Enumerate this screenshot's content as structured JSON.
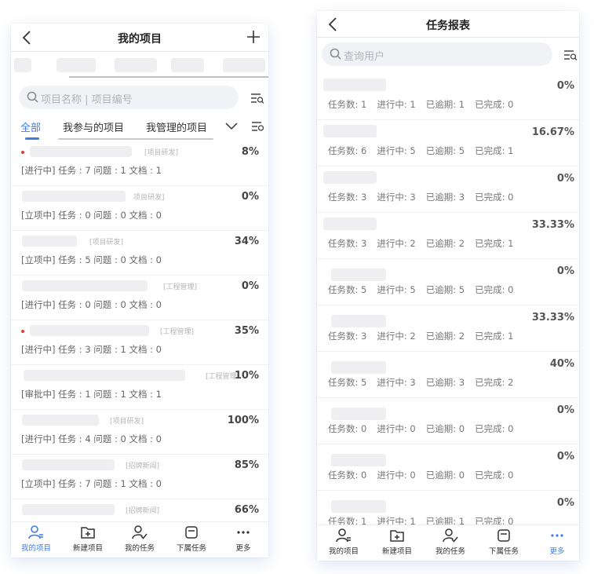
{
  "left_screen": {
    "title": "我的项目",
    "search_placeholder": "项目名称 | 项目编号",
    "tabs": [
      "全部",
      "我参与的项目",
      "我管理的项目"
    ],
    "projects": [
      {
        "tag": "[项目研发]",
        "percent": "8%",
        "meta": "[进行中] 任务 : 7 问题 : 1 文档 : 1",
        "has_dot": true
      },
      {
        "tag": "项目研发]",
        "percent": "0%",
        "meta": "[立项中] 任务 : 0 问题 : 0 文档 : 0",
        "has_dot": false
      },
      {
        "tag": "[项目研发]",
        "percent": "34%",
        "meta": "[立项中] 任务 : 5 问题 : 0 文档 : 0",
        "has_dot": false
      },
      {
        "tag": "[工程管理]",
        "percent": "0%",
        "meta": "[进行中] 任务 : 0 问题 : 0 文档 : 0",
        "has_dot": false
      },
      {
        "tag": "[工程管理]",
        "percent": "35%",
        "meta": "[进行中] 任务 : 3 问题 : 1 文档 : 0",
        "has_dot": true
      },
      {
        "tag": "[工程管理]",
        "percent": "10%",
        "meta": "[审批中] 任务 : 1 问题 : 1 文档 : 1",
        "has_dot": false
      },
      {
        "tag": "[项目研发]",
        "percent": "100%",
        "meta": "[进行中] 任务 : 4 问题 : 0 文档 : 0",
        "has_dot": false
      },
      {
        "tag": "[招牌新闻]",
        "percent": "85%",
        "meta": "[立项中] 任务 : 7 问题 : 1 文档 : 0",
        "has_dot": false
      },
      {
        "tag": "[招牌新闻]",
        "percent": "66%",
        "meta": "",
        "has_dot": false
      }
    ]
  },
  "right_screen": {
    "title": "任务报表",
    "search_placeholder": "查询用户",
    "rows": [
      {
        "percent": "0%",
        "tasks": "任务数: 1",
        "in_progress": "进行中: 1",
        "overdue": "已逾期: 1",
        "done": "已完成: 0"
      },
      {
        "percent": "16.67%",
        "tasks": "任务数: 6",
        "in_progress": "进行中: 5",
        "overdue": "已逾期: 5",
        "done": "已完成: 1"
      },
      {
        "percent": "0%",
        "tasks": "任务数: 3",
        "in_progress": "进行中: 3",
        "overdue": "已逾期: 3",
        "done": "已完成: 0"
      },
      {
        "percent": "33.33%",
        "tasks": "任务数: 3",
        "in_progress": "进行中: 2",
        "overdue": "已逾期: 2",
        "done": "已完成: 1"
      },
      {
        "percent": "0%",
        "tasks": "任务数: 5",
        "in_progress": "进行中: 5",
        "overdue": "已逾期: 5",
        "done": "已完成: 0"
      },
      {
        "percent": "33.33%",
        "tasks": "任务数: 3",
        "in_progress": "进行中: 2",
        "overdue": "已逾期: 2",
        "done": "已完成: 1"
      },
      {
        "percent": "40%",
        "tasks": "任务数: 5",
        "in_progress": "进行中: 3",
        "overdue": "已逾期: 3",
        "done": "已完成: 2"
      },
      {
        "percent": "0%",
        "tasks": "任务数: 0",
        "in_progress": "进行中: 0",
        "overdue": "已逾期: 0",
        "done": "已完成: 0"
      },
      {
        "percent": "0%",
        "tasks": "任务数: 0",
        "in_progress": "进行中: 0",
        "overdue": "已逾期: 0",
        "done": "已完成: 0"
      },
      {
        "percent": "0%",
        "tasks": "任务数: 1",
        "in_progress": "进行中: 1",
        "overdue": "已逾期: 1",
        "done": "已完成: 0"
      }
    ]
  },
  "tabbar": [
    "我的项目",
    "新建项目",
    "我的任务",
    "下属任务",
    "更多"
  ],
  "colors": {
    "accent": "#3d7de8",
    "danger": "#e53935",
    "skeleton": "#efeff1"
  },
  "icons": [
    "back-icon",
    "plus-icon",
    "search-icon",
    "filter-icon",
    "chevron-down-icon",
    "user-list-icon",
    "folder-plus-icon",
    "user-check-icon",
    "tray-icon",
    "more-icon"
  ]
}
